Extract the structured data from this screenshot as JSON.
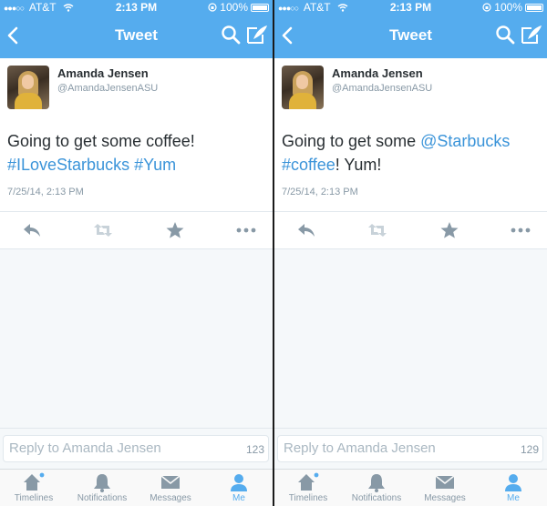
{
  "theme": {
    "accent": "#55acee",
    "link": "#3b94d9",
    "text": "#292f33",
    "muted": "#8899a6"
  },
  "screens": [
    {
      "status": {
        "carrier": "AT&T",
        "time": "2:13 PM",
        "battery": "100%"
      },
      "nav": {
        "title": "Tweet",
        "icons": [
          "back-chevron-icon",
          "search-icon",
          "compose-icon"
        ]
      },
      "tweet": {
        "name": "Amanda Jensen",
        "handle": "@AmandaJensenASU",
        "segments": [
          {
            "text": "Going to get some coffee! "
          },
          {
            "text": "#ILoveStarbucks",
            "link": true
          },
          {
            "text": " "
          },
          {
            "text": "#Yum",
            "link": true
          }
        ],
        "date": "7/25/14, 2:13 PM"
      },
      "actions": [
        "reply-icon",
        "retweet-icon",
        "favorite-icon",
        "more-icon"
      ],
      "reply": {
        "placeholder": "Reply to Amanda Jensen",
        "count": "123"
      },
      "tabs": [
        {
          "label": "Timelines",
          "icon": "home-icon",
          "active": false,
          "badge": true
        },
        {
          "label": "Notifications",
          "icon": "bell-icon",
          "active": false
        },
        {
          "label": "Messages",
          "icon": "envelope-icon",
          "active": false
        },
        {
          "label": "Me",
          "icon": "person-icon",
          "active": true
        }
      ]
    },
    {
      "status": {
        "carrier": "AT&T",
        "time": "2:13 PM",
        "battery": "100%"
      },
      "nav": {
        "title": "Tweet",
        "icons": [
          "back-chevron-icon",
          "search-icon",
          "compose-icon"
        ]
      },
      "tweet": {
        "name": "Amanda Jensen",
        "handle": "@AmandaJensenASU",
        "segments": [
          {
            "text": "Going to get some "
          },
          {
            "text": "@Starbucks",
            "link": true
          },
          {
            "text": " "
          },
          {
            "text": "#coffee",
            "link": true
          },
          {
            "text": "! Yum!"
          }
        ],
        "date": "7/25/14, 2:13 PM"
      },
      "actions": [
        "reply-icon",
        "retweet-icon",
        "favorite-icon",
        "more-icon"
      ],
      "reply": {
        "placeholder": "Reply to Amanda Jensen",
        "count": "129"
      },
      "tabs": [
        {
          "label": "Timelines",
          "icon": "home-icon",
          "active": false,
          "badge": true
        },
        {
          "label": "Notifications",
          "icon": "bell-icon",
          "active": false
        },
        {
          "label": "Messages",
          "icon": "envelope-icon",
          "active": false
        },
        {
          "label": "Me",
          "icon": "person-icon",
          "active": true
        }
      ]
    }
  ]
}
